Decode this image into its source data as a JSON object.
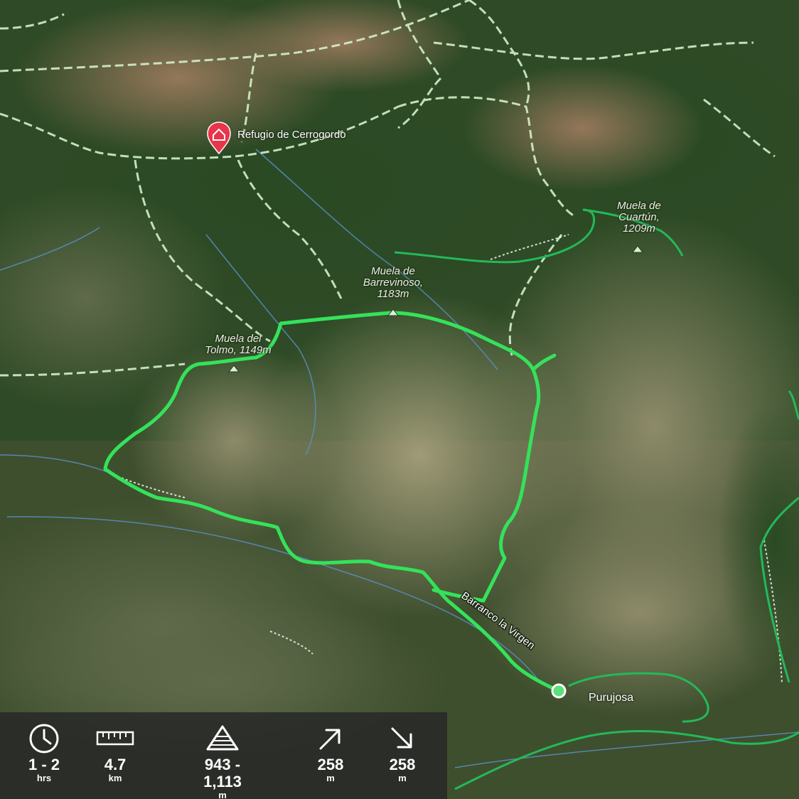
{
  "map": {
    "hut": {
      "name": "Refugio de Cerrogordo",
      "icon": "hut-marker-icon"
    },
    "peaks": [
      {
        "line1": "Muela de",
        "line2": "Cuartún,",
        "line3": "1209m",
        "icon": "peak-triangle-icon"
      },
      {
        "line1": "Muela de",
        "line2": "Barrevinoso,",
        "line3": "1183m",
        "icon": "peak-triangle-icon"
      },
      {
        "line1": "Muela del",
        "line2": "Tolmo, 1149m",
        "icon": "peak-triangle-icon"
      }
    ],
    "stream_label": "Barranco la Virgen",
    "town": "Purujosa",
    "colors": {
      "route": "#34e25a",
      "trail": "#c9ecc3",
      "stream": "#5b8ec4",
      "hut_marker": "#e8354c"
    }
  },
  "stats": [
    {
      "icon": "clock-icon",
      "value": "1 - 2",
      "unit": "hrs"
    },
    {
      "icon": "ruler-icon",
      "value": "4.7",
      "unit": "km"
    },
    {
      "icon": "elevation-icon",
      "value": "943 - 1,113",
      "unit": "m"
    },
    {
      "icon": "ascent-arrow-icon",
      "value": "258",
      "unit": "m"
    },
    {
      "icon": "descent-arrow-icon",
      "value": "258",
      "unit": "m"
    }
  ]
}
